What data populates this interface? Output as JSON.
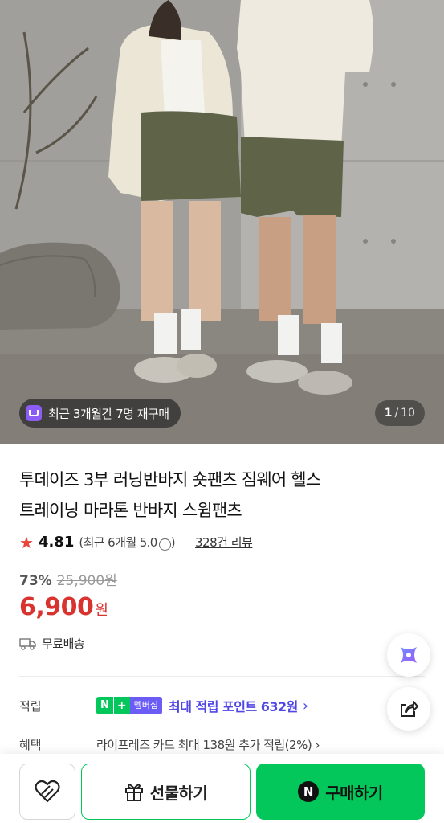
{
  "hero": {
    "repurchase_badge": "최근 3개월간 7명 재구매",
    "counter_current": "1",
    "counter_total": "10",
    "icons": [
      "shopping-bag-icon"
    ]
  },
  "product": {
    "title_line1": "투데이즈 3부 러닝반바지 숏팬츠 짐웨어 헬스",
    "title_line2": "트레이닝 마라톤 반바지 스윔팬츠",
    "rating": "4.81",
    "recent_rating_prefix": "(최근 6개월 5.0",
    "recent_rating_suffix": ")",
    "info_symbol": "i",
    "review_link": "328건 리뷰",
    "discount": "73%",
    "original_price": "25,900원",
    "price": "6,900",
    "currency": "원",
    "shipping": "무료배송"
  },
  "points": {
    "label": "적립",
    "badge_n": "N",
    "badge_plus": "+",
    "badge_member": "멤버십",
    "text": "최대 적립 포인트 632원",
    "chevron": "›"
  },
  "benefit": {
    "label": "혜택",
    "text": "라이프레즈 카드 최대 138원 추가 적립(2%) ›"
  },
  "bottom_bar": {
    "gift_label": "선물하기",
    "buy_label": "구매하기",
    "buy_icon_letter": "N"
  },
  "colors": {
    "accent_green": "#03c75a",
    "price_red": "#d9332f",
    "points_purple": "#4f46e5",
    "star_red": "#e8453c"
  }
}
